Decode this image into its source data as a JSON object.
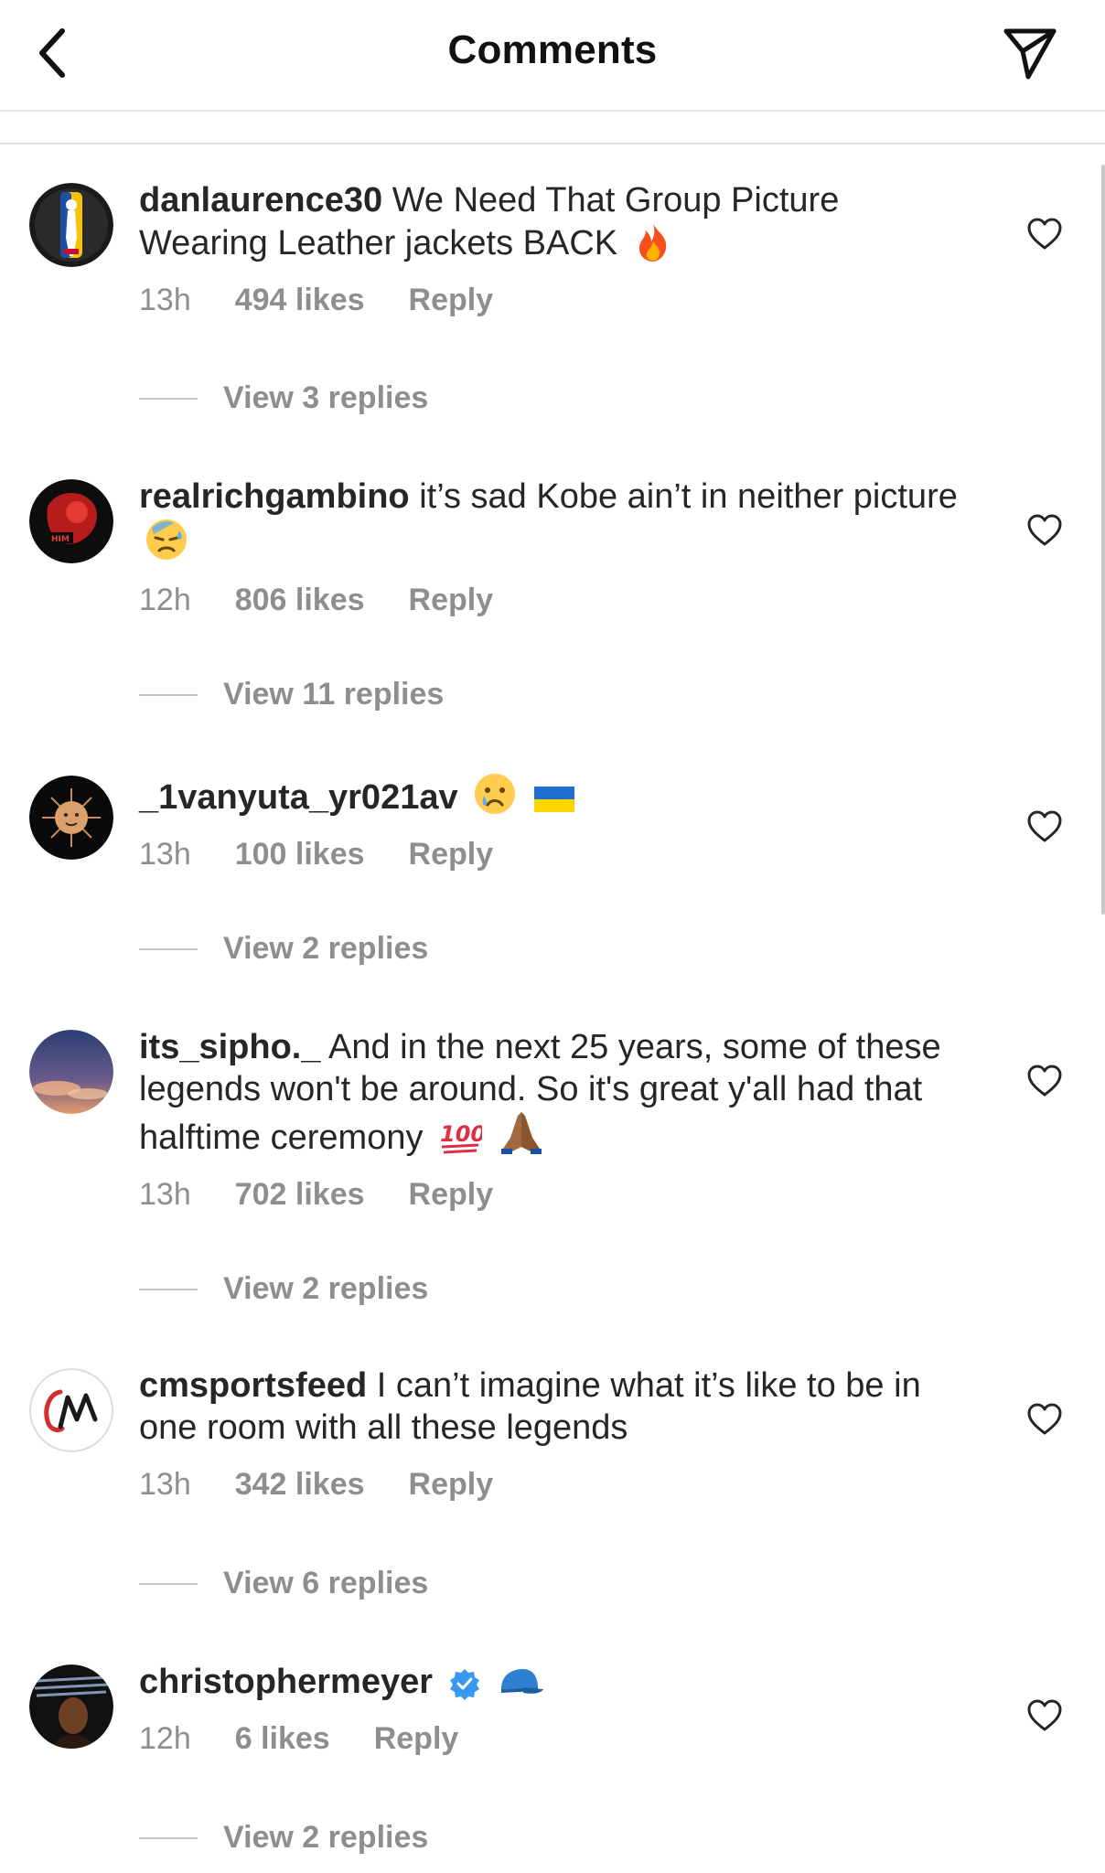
{
  "header": {
    "title": "Comments",
    "back_icon": "chevron-left-icon",
    "share_icon": "paper-plane-icon"
  },
  "comments": [
    {
      "username": "danlaurence30",
      "text": "We Need That Group Picture Wearing Leather jackets BACK",
      "emoji": "fire-emoji",
      "time": "13h",
      "likes": "494 likes",
      "reply": "Reply",
      "view_replies": "View 3 replies"
    },
    {
      "username": "realrichgambino",
      "text": "it’s sad Kobe ain’t in neither picture",
      "emoji": "downcast-sweat-emoji",
      "time": "12h",
      "likes": "806 likes",
      "reply": "Reply",
      "view_replies": "View 11 replies"
    },
    {
      "username": "_1vanyuta_yr021av",
      "text": "",
      "emoji": "crying-face-emoji ukraine-flag-emoji",
      "time": "13h",
      "likes": "100 likes",
      "reply": "Reply",
      "view_replies": "View 2 replies"
    },
    {
      "username": "its_sipho._",
      "text": "And in the next 25 years, some of these legends won't be around. So it's great y'all had that halftime ceremony",
      "emoji": "hundred-points-emoji folded-hands-emoji",
      "time": "13h",
      "likes": "702 likes",
      "reply": "Reply",
      "view_replies": "View 2 replies"
    },
    {
      "username": "cmsportsfeed",
      "text": "I can’t imagine what it’s like to be in one room with all these legends",
      "emoji": "",
      "time": "13h",
      "likes": "342 likes",
      "reply": "Reply",
      "view_replies": "View 6 replies"
    },
    {
      "username": "christophermeyer",
      "text": "",
      "emoji": "verified-badge-icon blue-cap-emoji",
      "time": "12h",
      "likes": "6 likes",
      "reply": "Reply",
      "view_replies": "View 2 replies"
    }
  ],
  "colors": {
    "text": "#262626",
    "secondary": "#8e8e8e",
    "verified": "#3897f0"
  }
}
